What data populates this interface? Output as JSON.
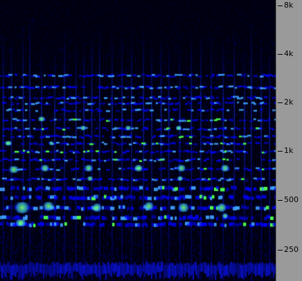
{
  "spectrogram": {
    "colors": {
      "background": "#000010",
      "low": "#0000ff",
      "mid": "#3fa0ff",
      "high": "#4dff4d"
    }
  },
  "frequency_axis": {
    "labels": [
      "8k",
      "4k",
      "2k",
      "1k",
      "500",
      "250"
    ]
  }
}
